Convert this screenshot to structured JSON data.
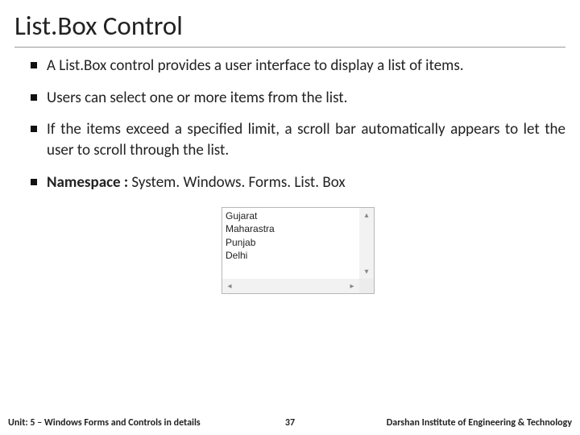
{
  "title": "List.Box Control",
  "bullets": {
    "b0": "A List.Box control provides a user interface to display a list of items.",
    "b1": "Users can select one or more items from the list.",
    "b2": "If the items exceed a specified limit, a scroll bar automatically appears to let the user to scroll through the list.",
    "b3_label": "Namespace :",
    "b3_value": " System. Windows. Forms. List. Box"
  },
  "listbox": {
    "items": [
      "Gujarat",
      "Maharastra",
      "Punjab",
      "Delhi"
    ]
  },
  "footer": {
    "left": "Unit: 5 – Windows Forms and Controls in details",
    "page": "37",
    "right": "Darshan Institute of Engineering & Technology"
  }
}
